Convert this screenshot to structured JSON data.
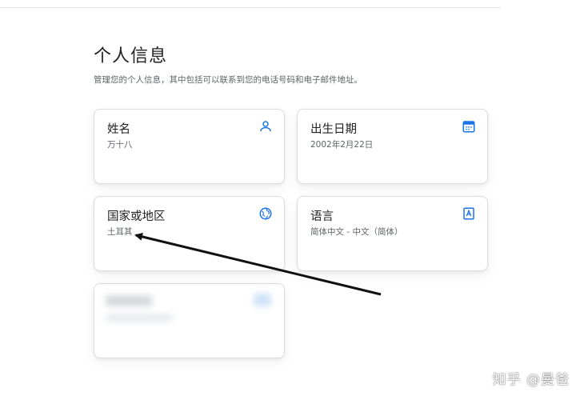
{
  "page": {
    "title": "个人信息",
    "description": "管理您的个人信息，其中包括可以联系到您的电话号码和电子邮件地址。"
  },
  "cards": {
    "name": {
      "label": "姓名",
      "value": "万十八",
      "icon": "person-icon"
    },
    "birthday": {
      "label": "出生日期",
      "value": "2002年2月22日",
      "icon": "calendar-icon"
    },
    "region": {
      "label": "国家或地区",
      "value": "土耳其",
      "icon": "globe-icon"
    },
    "language": {
      "label": "语言",
      "value": "简体中文 - 中文（简体）",
      "icon": "language-book-icon"
    }
  },
  "watermark": "知乎 @曼爸",
  "colors": {
    "accent": "#1a73e8",
    "annotation_arrow": "#111111"
  }
}
